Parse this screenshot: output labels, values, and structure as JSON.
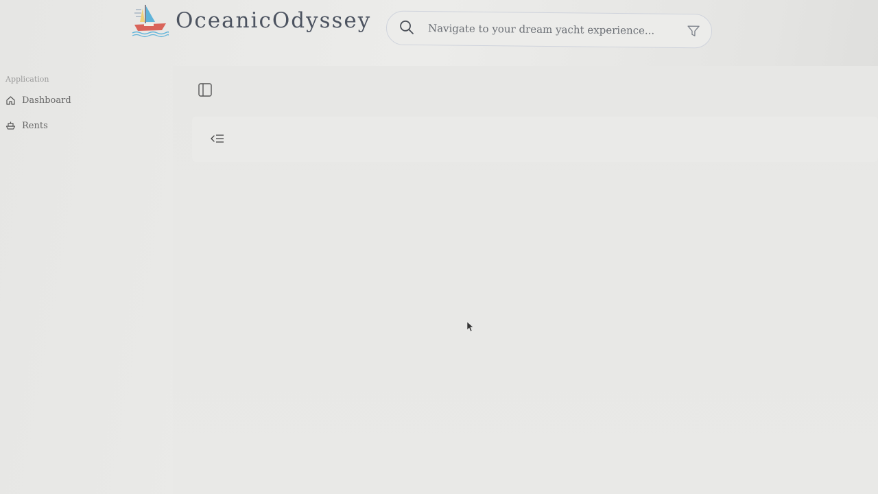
{
  "brand": {
    "name": "OceanicOdyssey",
    "logo_icon": "sailboat-icon"
  },
  "search": {
    "placeholder": "Navigate to your dream yacht experience...",
    "value": "",
    "search_icon": "search-icon",
    "filter_icon": "filter-icon"
  },
  "sidebar": {
    "group_label": "Application",
    "items": [
      {
        "label": "Dashboard",
        "icon": "home-icon"
      },
      {
        "label": "Rents",
        "icon": "yacht-icon"
      }
    ]
  },
  "main": {
    "toggle_icon": "sidebar-toggle-icon",
    "collapse_icon": "collapse-menu-icon"
  },
  "colors": {
    "background": "#e8e8e6",
    "brand_text": "#4c5360",
    "logo_blue": "#5fb3d9",
    "logo_red": "#d9645a"
  }
}
